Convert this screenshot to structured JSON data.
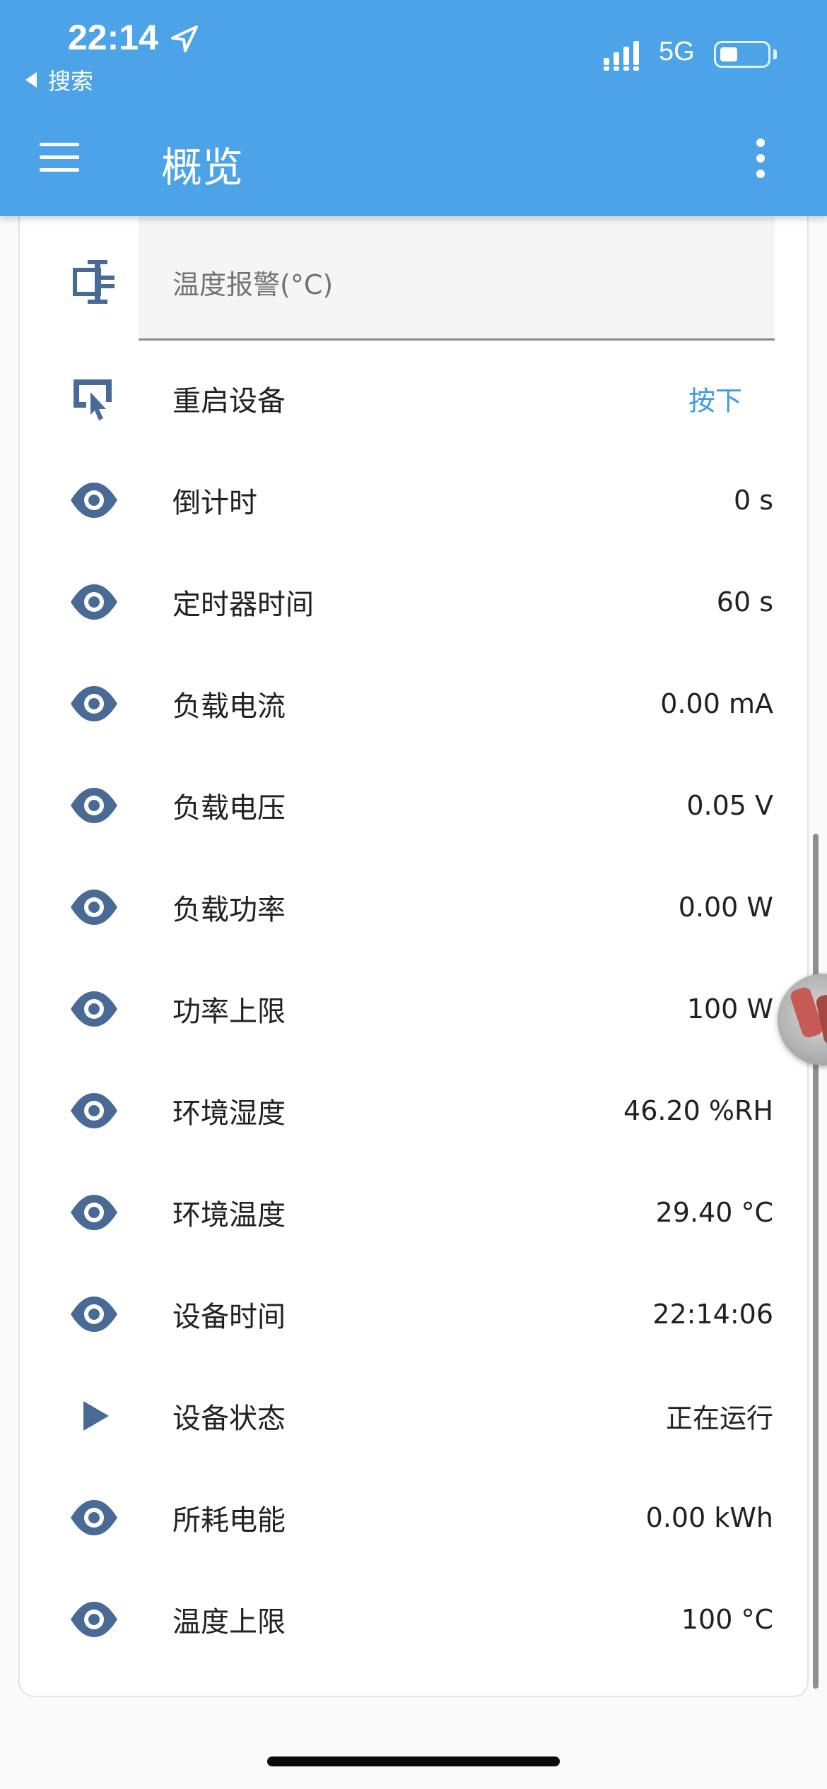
{
  "status_bar": {
    "time": "22:14",
    "back_label": "搜索",
    "network": "5G"
  },
  "header": {
    "title": "概览",
    "menu_icon": "hamburger-menu-icon",
    "more_icon": "more-vert-icon"
  },
  "temperature_alarm": {
    "label": "温度报警(°C)",
    "value": "",
    "icon": "input-field-icon"
  },
  "restart": {
    "label": "重启设备",
    "action": "按下",
    "icon": "touch-screen-icon"
  },
  "rows": [
    {
      "label": "倒计时",
      "value": "0 s",
      "icon": "eye-icon"
    },
    {
      "label": "定时器时间",
      "value": "60 s",
      "icon": "eye-icon"
    },
    {
      "label": "负载电流",
      "value": "0.00 mA",
      "icon": "eye-icon"
    },
    {
      "label": "负载电压",
      "value": "0.05 V",
      "icon": "eye-icon"
    },
    {
      "label": "负载功率",
      "value": "0.00 W",
      "icon": "eye-icon"
    },
    {
      "label": "功率上限",
      "value": "100 W",
      "icon": "eye-icon"
    },
    {
      "label": "环境湿度",
      "value": "46.20 %RH",
      "icon": "eye-icon"
    },
    {
      "label": "环境温度",
      "value": "29.40 °C",
      "icon": "eye-icon"
    },
    {
      "label": "设备时间",
      "value": "22:14:06",
      "icon": "eye-icon"
    },
    {
      "label": "设备状态",
      "value": "正在运行",
      "icon": "play-icon"
    },
    {
      "label": "所耗电能",
      "value": "0.00 kWh",
      "icon": "eye-icon"
    },
    {
      "label": "温度上限",
      "value": "100 °C",
      "icon": "eye-icon"
    }
  ],
  "colors": {
    "header": "#4ca3e8",
    "icon": "#4a6a96",
    "action": "#3f9ae6"
  }
}
